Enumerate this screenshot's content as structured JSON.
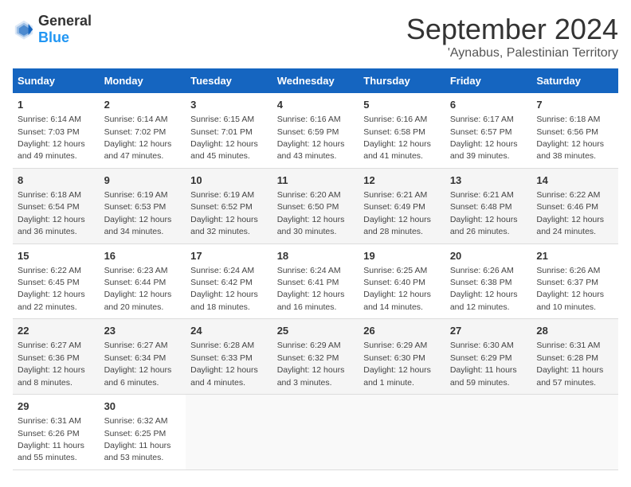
{
  "logo": {
    "general": "General",
    "blue": "Blue"
  },
  "header": {
    "month": "September 2024",
    "location": "'Aynabus, Palestinian Territory"
  },
  "days_of_week": [
    "Sunday",
    "Monday",
    "Tuesday",
    "Wednesday",
    "Thursday",
    "Friday",
    "Saturday"
  ],
  "weeks": [
    [
      {
        "day": "1",
        "sunrise": "6:14 AM",
        "sunset": "7:03 PM",
        "daylight": "12 hours and 49 minutes."
      },
      {
        "day": "2",
        "sunrise": "6:14 AM",
        "sunset": "7:02 PM",
        "daylight": "12 hours and 47 minutes."
      },
      {
        "day": "3",
        "sunrise": "6:15 AM",
        "sunset": "7:01 PM",
        "daylight": "12 hours and 45 minutes."
      },
      {
        "day": "4",
        "sunrise": "6:16 AM",
        "sunset": "6:59 PM",
        "daylight": "12 hours and 43 minutes."
      },
      {
        "day": "5",
        "sunrise": "6:16 AM",
        "sunset": "6:58 PM",
        "daylight": "12 hours and 41 minutes."
      },
      {
        "day": "6",
        "sunrise": "6:17 AM",
        "sunset": "6:57 PM",
        "daylight": "12 hours and 39 minutes."
      },
      {
        "day": "7",
        "sunrise": "6:18 AM",
        "sunset": "6:56 PM",
        "daylight": "12 hours and 38 minutes."
      }
    ],
    [
      {
        "day": "8",
        "sunrise": "6:18 AM",
        "sunset": "6:54 PM",
        "daylight": "12 hours and 36 minutes."
      },
      {
        "day": "9",
        "sunrise": "6:19 AM",
        "sunset": "6:53 PM",
        "daylight": "12 hours and 34 minutes."
      },
      {
        "day": "10",
        "sunrise": "6:19 AM",
        "sunset": "6:52 PM",
        "daylight": "12 hours and 32 minutes."
      },
      {
        "day": "11",
        "sunrise": "6:20 AM",
        "sunset": "6:50 PM",
        "daylight": "12 hours and 30 minutes."
      },
      {
        "day": "12",
        "sunrise": "6:21 AM",
        "sunset": "6:49 PM",
        "daylight": "12 hours and 28 minutes."
      },
      {
        "day": "13",
        "sunrise": "6:21 AM",
        "sunset": "6:48 PM",
        "daylight": "12 hours and 26 minutes."
      },
      {
        "day": "14",
        "sunrise": "6:22 AM",
        "sunset": "6:46 PM",
        "daylight": "12 hours and 24 minutes."
      }
    ],
    [
      {
        "day": "15",
        "sunrise": "6:22 AM",
        "sunset": "6:45 PM",
        "daylight": "12 hours and 22 minutes."
      },
      {
        "day": "16",
        "sunrise": "6:23 AM",
        "sunset": "6:44 PM",
        "daylight": "12 hours and 20 minutes."
      },
      {
        "day": "17",
        "sunrise": "6:24 AM",
        "sunset": "6:42 PM",
        "daylight": "12 hours and 18 minutes."
      },
      {
        "day": "18",
        "sunrise": "6:24 AM",
        "sunset": "6:41 PM",
        "daylight": "12 hours and 16 minutes."
      },
      {
        "day": "19",
        "sunrise": "6:25 AM",
        "sunset": "6:40 PM",
        "daylight": "12 hours and 14 minutes."
      },
      {
        "day": "20",
        "sunrise": "6:26 AM",
        "sunset": "6:38 PM",
        "daylight": "12 hours and 12 minutes."
      },
      {
        "day": "21",
        "sunrise": "6:26 AM",
        "sunset": "6:37 PM",
        "daylight": "12 hours and 10 minutes."
      }
    ],
    [
      {
        "day": "22",
        "sunrise": "6:27 AM",
        "sunset": "6:36 PM",
        "daylight": "12 hours and 8 minutes."
      },
      {
        "day": "23",
        "sunrise": "6:27 AM",
        "sunset": "6:34 PM",
        "daylight": "12 hours and 6 minutes."
      },
      {
        "day": "24",
        "sunrise": "6:28 AM",
        "sunset": "6:33 PM",
        "daylight": "12 hours and 4 minutes."
      },
      {
        "day": "25",
        "sunrise": "6:29 AM",
        "sunset": "6:32 PM",
        "daylight": "12 hours and 3 minutes."
      },
      {
        "day": "26",
        "sunrise": "6:29 AM",
        "sunset": "6:30 PM",
        "daylight": "12 hours and 1 minute."
      },
      {
        "day": "27",
        "sunrise": "6:30 AM",
        "sunset": "6:29 PM",
        "daylight": "11 hours and 59 minutes."
      },
      {
        "day": "28",
        "sunrise": "6:31 AM",
        "sunset": "6:28 PM",
        "daylight": "11 hours and 57 minutes."
      }
    ],
    [
      {
        "day": "29",
        "sunrise": "6:31 AM",
        "sunset": "6:26 PM",
        "daylight": "11 hours and 55 minutes."
      },
      {
        "day": "30",
        "sunrise": "6:32 AM",
        "sunset": "6:25 PM",
        "daylight": "11 hours and 53 minutes."
      },
      null,
      null,
      null,
      null,
      null
    ]
  ]
}
